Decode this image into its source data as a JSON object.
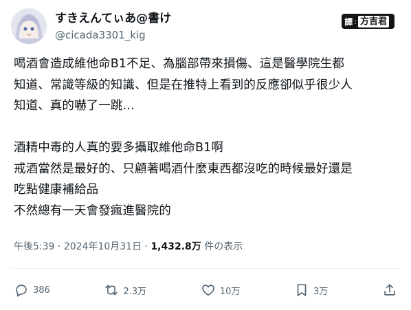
{
  "author": {
    "display_name": "すきえんてぃあ@書け",
    "handle": "@cicada3301_kig"
  },
  "badge": {
    "char1": "譯",
    "char2": "方吉君"
  },
  "tweet": {
    "text": "喝酒會造成維他命B1不足、為腦部帶來損傷、這是醫學院生都\n知道、常識等級的知識、但是在推特上看到的反應卻似乎很少人\n知道、真的嚇了一跳…\n\n酒精中毒的人真的要多攝取維他命B1啊\n戒酒當然是最好的、只顧著喝酒什麼東西都沒吃的時候最好還是\n吃點健康補給品\n不然總有一天會發瘋進醫院的"
  },
  "meta": {
    "time": "午後5:39",
    "sep1": " · ",
    "date": "2024年10月31日",
    "sep2": " · ",
    "views": "1,432.8万",
    "views_label": " 件の表示"
  },
  "actions": {
    "reply_count": "386",
    "retweet_count": "2.3万",
    "like_count": "10万",
    "bookmark_count": "3万"
  },
  "colors": {
    "text": "#0f1419",
    "secondary": "#536471",
    "divider": "#eff3f4"
  },
  "icons": [
    "reply-icon",
    "retweet-icon",
    "like-icon",
    "bookmark-icon",
    "share-icon"
  ]
}
